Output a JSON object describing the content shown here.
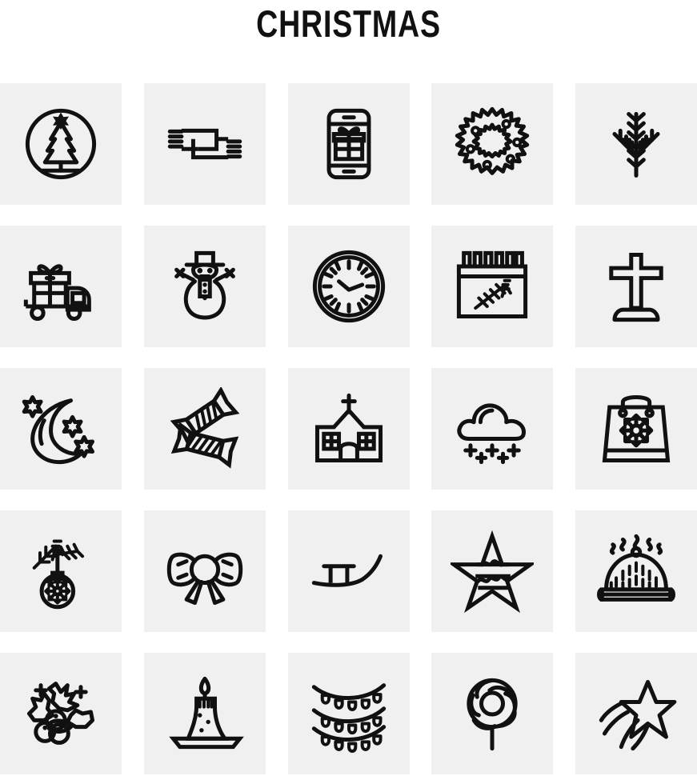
{
  "page": {
    "title": "CHRISTMAS",
    "background_color": "#ffffff",
    "tile_color": "#f0f0f0",
    "icon_color": "#111111",
    "grid": {
      "columns": 5,
      "rows": 5,
      "total_icons": 25
    }
  },
  "icons": [
    {
      "index": 1,
      "name": "christmas-tree-in-circle-icon",
      "label": "Christmas Tree"
    },
    {
      "index": 2,
      "name": "scarf-icon",
      "label": "Scarf"
    },
    {
      "index": 3,
      "name": "mobile-gift-icon",
      "label": "Mobile Gift"
    },
    {
      "index": 4,
      "name": "wreath-icon",
      "label": "Wreath"
    },
    {
      "index": 5,
      "name": "pine-branches-icon",
      "label": "Pine Branches"
    },
    {
      "index": 6,
      "name": "gift-delivery-truck-icon",
      "label": "Gift Delivery Truck"
    },
    {
      "index": 7,
      "name": "snowman-icon",
      "label": "Snowman"
    },
    {
      "index": 8,
      "name": "clock-icon",
      "label": "Clock"
    },
    {
      "index": 9,
      "name": "calendar-pine-icon",
      "label": "Calendar"
    },
    {
      "index": 10,
      "name": "cross-icon",
      "label": "Cross"
    },
    {
      "index": 11,
      "name": "moon-and-stars-icon",
      "label": "Moon and Stars"
    },
    {
      "index": 12,
      "name": "candy-icon",
      "label": "Candies"
    },
    {
      "index": 13,
      "name": "church-icon",
      "label": "Church"
    },
    {
      "index": 14,
      "name": "snow-cloud-icon",
      "label": "Snow Cloud"
    },
    {
      "index": 15,
      "name": "shopping-bag-snowflake-icon",
      "label": "Shopping Bag"
    },
    {
      "index": 16,
      "name": "ornament-ball-branch-icon",
      "label": "Ornament Ball"
    },
    {
      "index": 17,
      "name": "bow-ribbon-icon",
      "label": "Bow"
    },
    {
      "index": 18,
      "name": "sled-icon",
      "label": "Sled"
    },
    {
      "index": 19,
      "name": "decorated-star-icon",
      "label": "Star"
    },
    {
      "index": 20,
      "name": "christmas-pudding-icon",
      "label": "Christmas Pudding"
    },
    {
      "index": 21,
      "name": "holly-berries-icon",
      "label": "Holly Berries"
    },
    {
      "index": 22,
      "name": "candle-icon",
      "label": "Candle"
    },
    {
      "index": 23,
      "name": "string-lights-icon",
      "label": "String Lights"
    },
    {
      "index": 24,
      "name": "lollipop-icon",
      "label": "Lollipop"
    },
    {
      "index": 25,
      "name": "shooting-star-icon",
      "label": "Shooting Star"
    }
  ]
}
